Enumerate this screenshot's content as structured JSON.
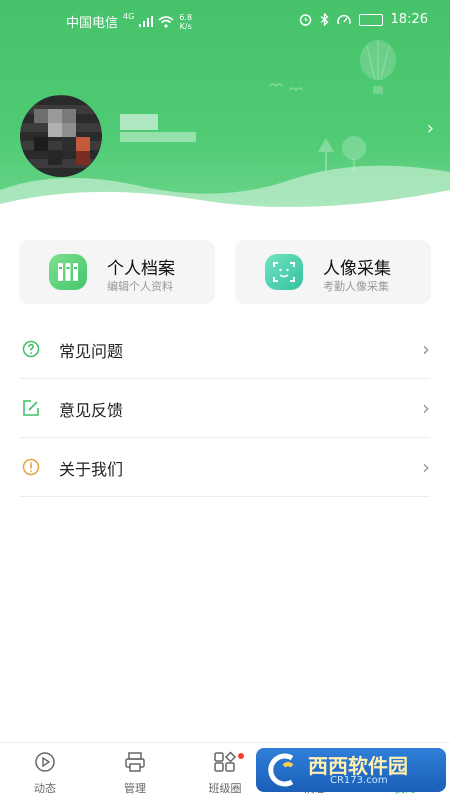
{
  "status_bar": {
    "carrier": "中国电信",
    "network": "4G",
    "speed_value": "6.8",
    "speed_unit": "K/s",
    "time": "18:26"
  },
  "profile": {
    "arrow": "›"
  },
  "cards": [
    {
      "title": "个人档案",
      "subtitle": "编辑个人资料",
      "icon": "archive-icon"
    },
    {
      "title": "人像采集",
      "subtitle": "考勤人像采集",
      "icon": "face-scan-icon"
    }
  ],
  "menu": [
    {
      "label": "常见问题",
      "icon": "question-circle-icon",
      "icon_color": "#3fbf66"
    },
    {
      "label": "意见反馈",
      "icon": "edit-square-icon",
      "icon_color": "#3fbf66"
    },
    {
      "label": "关于我们",
      "icon": "info-circle-icon",
      "icon_color": "#e6a23c"
    }
  ],
  "tabs": [
    {
      "label": "动态",
      "icon": "play-circle-icon",
      "active": false
    },
    {
      "label": "管理",
      "icon": "printer-icon",
      "active": false
    },
    {
      "label": "班级圈",
      "icon": "grid-icon",
      "active": false,
      "badge": true
    },
    {
      "label": "消息",
      "icon": "message-icon",
      "active": false
    },
    {
      "label": "我的",
      "icon": "user-icon",
      "active": true
    }
  ],
  "watermark": {
    "main": "西西软件园",
    "sub": "CR173.com"
  },
  "colors": {
    "brand_green": "#44c56c",
    "header_green": "#4fcb74",
    "chevron_gray": "#999999"
  }
}
